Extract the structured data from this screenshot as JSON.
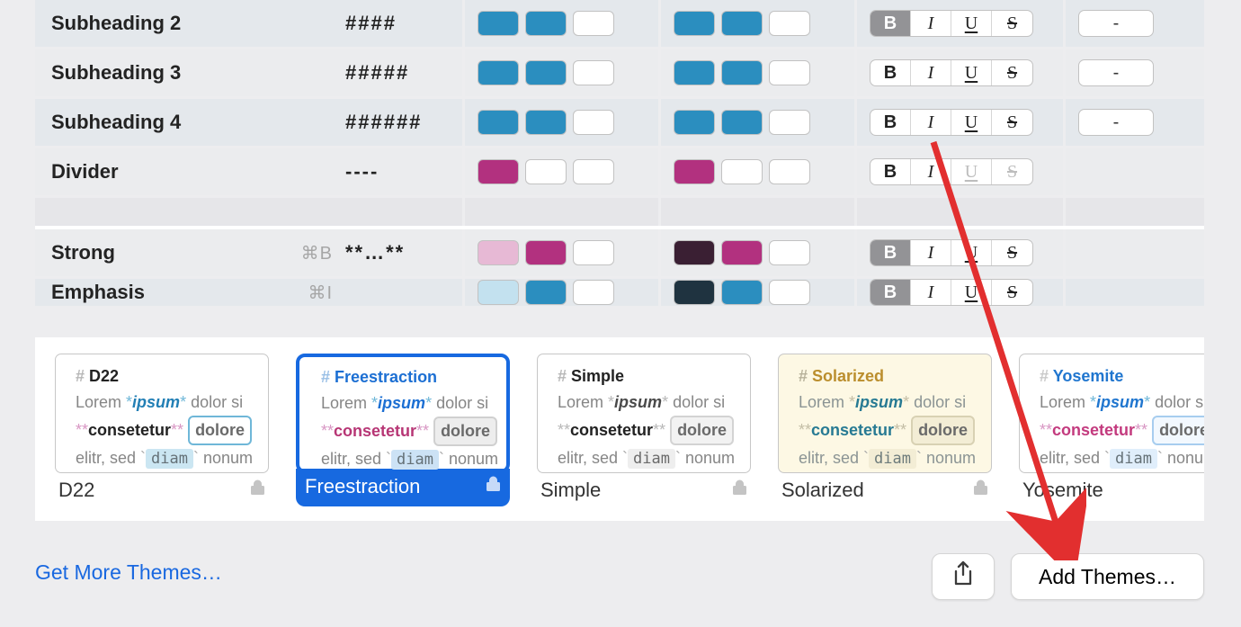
{
  "styleRows": [
    {
      "name": "Subheading 2",
      "syntax": "####",
      "kbd": "",
      "swA": [
        "#2b8ebf",
        "#2b8ebf",
        "#ffffff"
      ],
      "swB": [
        "#2b8ebf",
        "#2b8ebf",
        "#ffffff"
      ],
      "bold_active": true,
      "italic_dim": false,
      "under_dim": false,
      "strike_dim": false,
      "dash": "-"
    },
    {
      "name": "Subheading 3",
      "syntax": "#####",
      "kbd": "",
      "swA": [
        "#2b8ebf",
        "#2b8ebf",
        "#ffffff"
      ],
      "swB": [
        "#2b8ebf",
        "#2b8ebf",
        "#ffffff"
      ],
      "bold_active": false,
      "italic_dim": false,
      "under_dim": false,
      "strike_dim": false,
      "dash": "-"
    },
    {
      "name": "Subheading 4",
      "syntax": "######",
      "kbd": "",
      "swA": [
        "#2b8ebf",
        "#2b8ebf",
        "#ffffff"
      ],
      "swB": [
        "#2b8ebf",
        "#2b8ebf",
        "#ffffff"
      ],
      "bold_active": false,
      "italic_dim": false,
      "under_dim": false,
      "strike_dim": false,
      "dash": "-"
    },
    {
      "name": "Divider",
      "syntax": "----",
      "kbd": "",
      "swA": [
        "#b2317f",
        "#ffffff",
        "#ffffff"
      ],
      "swB": [
        "#b2317f",
        "#ffffff",
        "#ffffff"
      ],
      "bold_active": false,
      "italic_dim": false,
      "under_dim": true,
      "strike_dim": true,
      "dash": ""
    },
    {
      "spacer": true
    },
    {
      "name": "Strong",
      "syntax": "**…**",
      "kbd": "⌘B",
      "swA": [
        "#e7b9d5",
        "#b2317f",
        "#ffffff"
      ],
      "swB": [
        "#3a1f33",
        "#b2317f",
        "#ffffff"
      ],
      "bold_active": true,
      "italic_dim": false,
      "under_dim": false,
      "strike_dim": false,
      "dash": ""
    },
    {
      "name": "Emphasis",
      "syntax": "",
      "kbd": "⌘I",
      "swA": [
        "#c3e1ef",
        "#2b8ebf",
        "#ffffff"
      ],
      "swB": [
        "#1f3340",
        "#2b8ebf",
        "#ffffff"
      ],
      "bold_active": true,
      "italic_dim": false,
      "under_dim": false,
      "strike_dim": false,
      "dash": "",
      "cut": true
    }
  ],
  "bius": {
    "B": "B",
    "I": "I",
    "U": "U",
    "S": "S"
  },
  "themes": [
    {
      "id": "D22",
      "title": "D22",
      "heading": "D22",
      "selected": false,
      "cls": "tc-d22"
    },
    {
      "id": "Freestraction",
      "title": "Freestraction",
      "heading": "Freestraction",
      "selected": true,
      "cls": "tc-freestraction"
    },
    {
      "id": "Simple",
      "title": "Simple",
      "heading": "Simple",
      "selected": false,
      "cls": "tc-simple"
    },
    {
      "id": "Solarized",
      "title": "Solarized",
      "heading": "Solarized",
      "selected": false,
      "cls": "tc-solarized"
    },
    {
      "id": "Yosemite",
      "title": "Yosemite",
      "heading": "Yosemite",
      "selected": false,
      "cls": "tc-yosemite"
    }
  ],
  "preview": {
    "hash": "# ",
    "lorem": "Lorem ",
    "ipsum": "ipsum",
    "star": "*",
    "dolor_si": " dolor si",
    "double_star": "**",
    "consetetur": "consetetur",
    "close_stars": "** ",
    "dolore_pill": "dolore",
    "elitr": "elitr, sed ",
    "backtick": "`",
    "diam": "diam",
    "nonum": " nonum"
  },
  "footer": {
    "get_more": "Get More Themes…",
    "add_themes": "Add Themes…",
    "share_icon_glyph": "⇧"
  },
  "lock_icon": "🔒"
}
